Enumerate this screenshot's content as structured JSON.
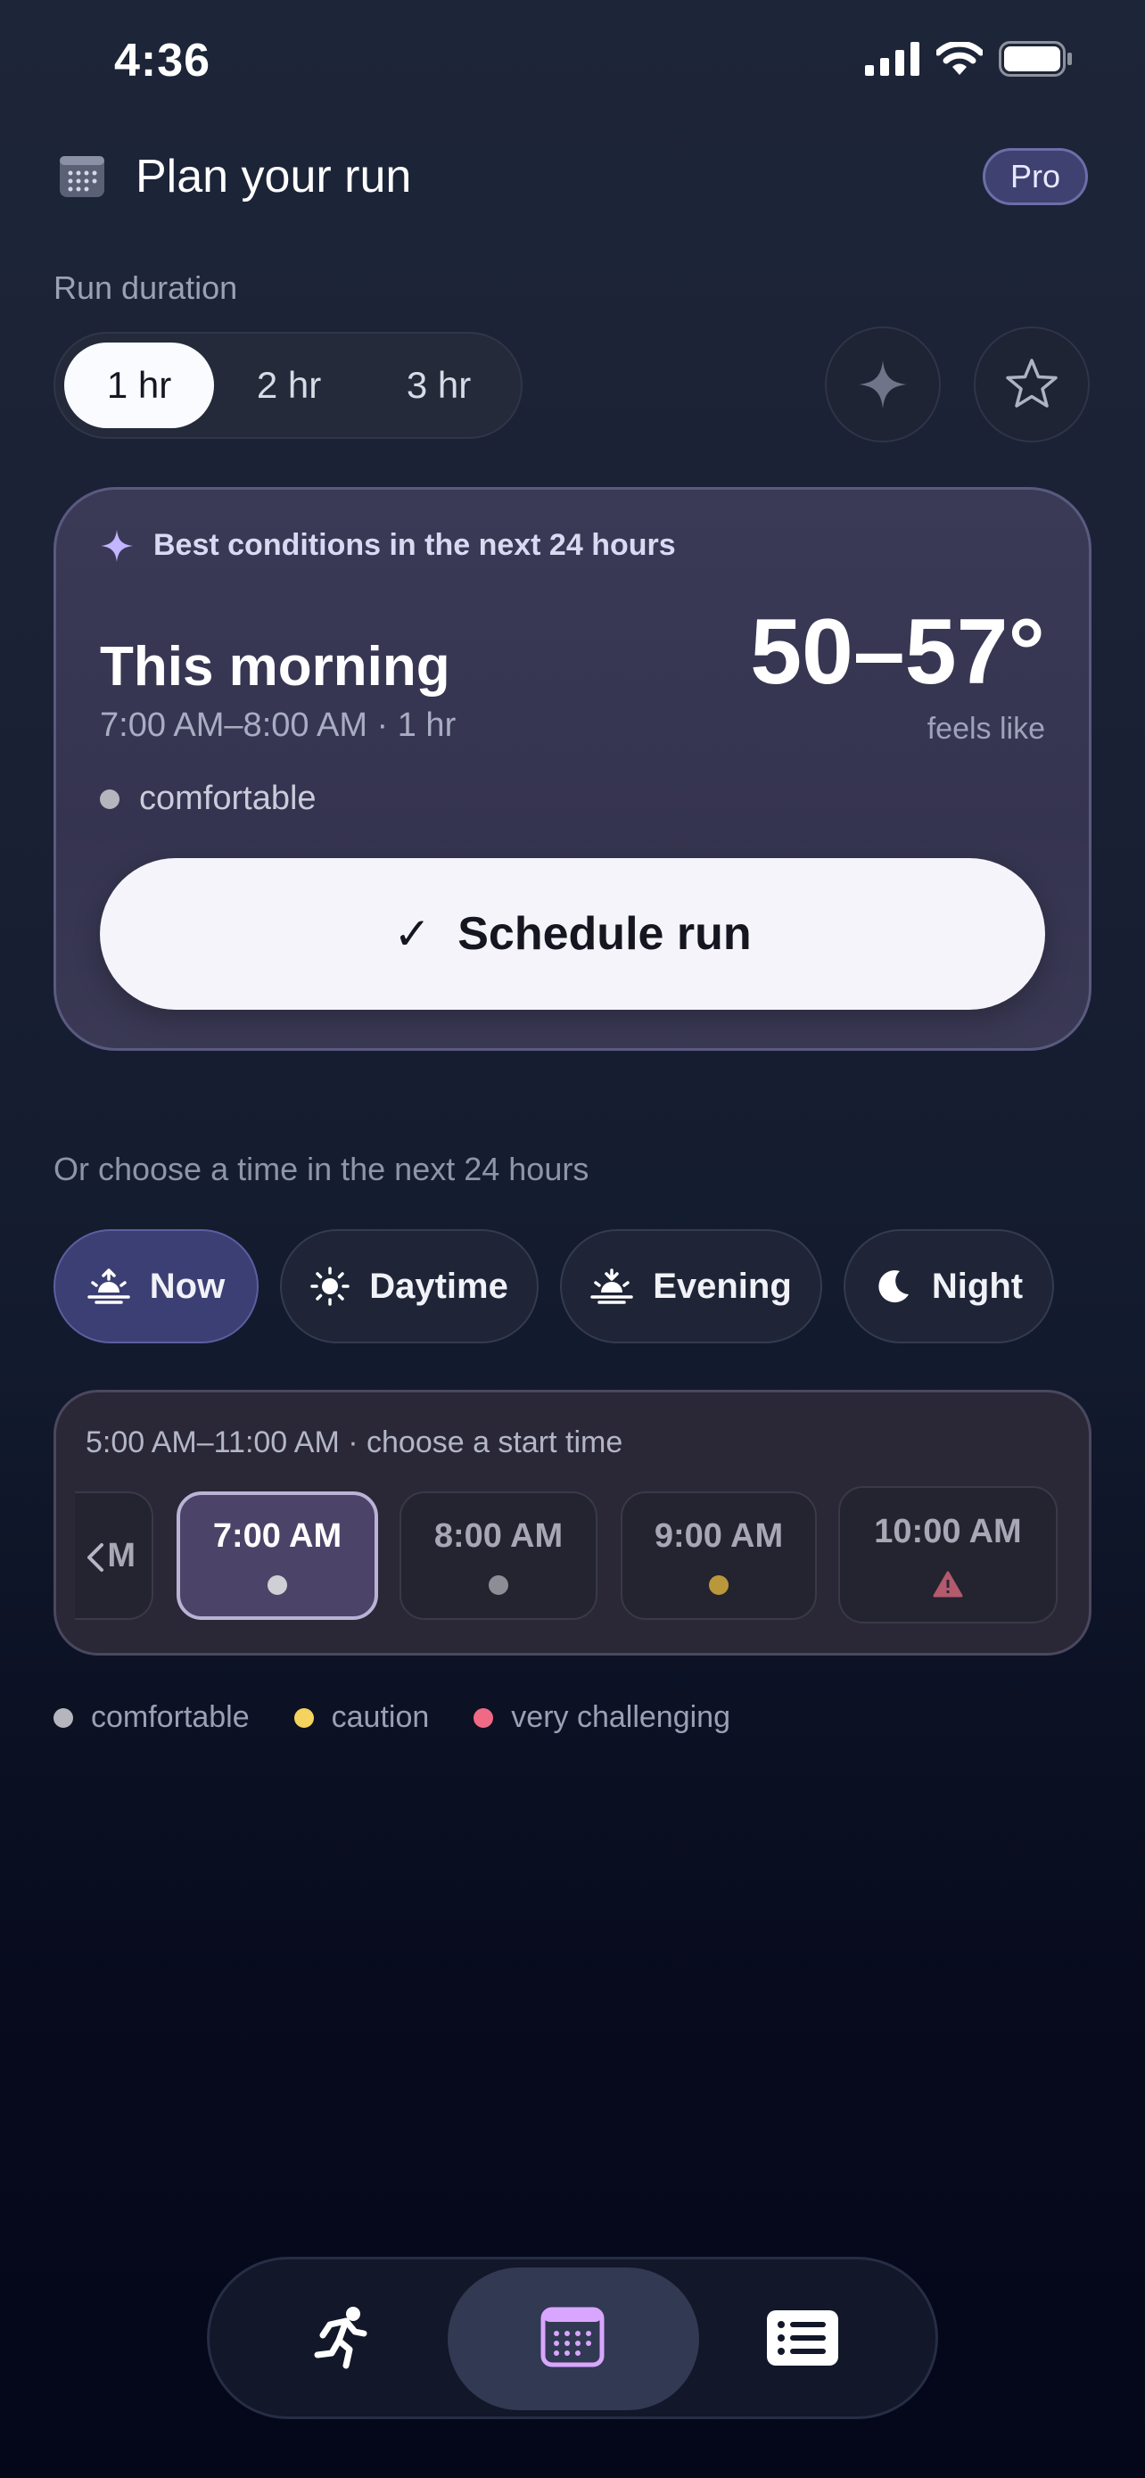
{
  "status_bar": {
    "time": "4:36"
  },
  "header": {
    "title": "Plan your run",
    "badge": "Pro",
    "icon": "calendar-icon"
  },
  "run_duration": {
    "label": "Run duration",
    "options": [
      "1 hr",
      "2 hr",
      "3 hr"
    ],
    "selected": "1 hr"
  },
  "best": {
    "heading": "Best conditions in the next 24 hours",
    "title": "This morning",
    "subtitle": "7:00 AM–8:00 AM · 1 hr",
    "temp": "50–57°",
    "feels_like": "feels like",
    "condition": "comfortable",
    "button_check": "✓",
    "button_label": "Schedule run"
  },
  "choose": {
    "label": "Or choose a time in the next 24 hours",
    "chips": [
      "Now",
      "Daytime",
      "Evening",
      "Night"
    ],
    "selected": "Now"
  },
  "slots": {
    "label": "5:00 AM–11:00 AM · choose a start time",
    "partial": "M",
    "times": [
      "7:00 AM",
      "8:00 AM",
      "9:00 AM",
      "10:00 AM"
    ],
    "selected": "7:00 AM"
  },
  "legend": [
    "comfortable",
    "caution",
    "very challenging"
  ],
  "colors": {
    "accent": "#3c3f73",
    "comfortable": "#b4b5bd",
    "caution": "#f4d35e",
    "very_challenging": "#f06a85",
    "tab_active_icon": "#d9a6ff"
  },
  "tabs": [
    "run-icon",
    "calendar-icon",
    "list-icon"
  ]
}
